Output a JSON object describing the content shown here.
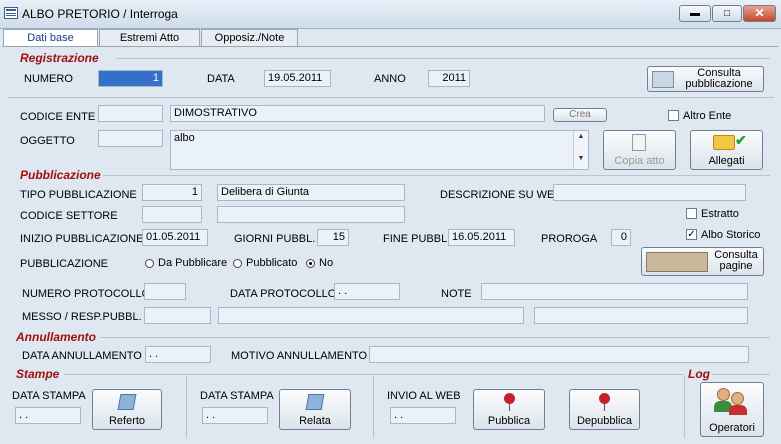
{
  "window": {
    "title": "ALBO PRETORIO / Interroga"
  },
  "tabs": [
    "Dati base",
    "Estremi Atto",
    "Opposiz./Note"
  ],
  "registrazione": {
    "heading": "Registrazione",
    "numero_label": "NUMERO",
    "numero": "1",
    "data_label": "DATA",
    "data": "19.05.2011",
    "anno_label": "ANNO",
    "anno": "2011",
    "consulta_pubb_btn": "Consulta pubblicazione"
  },
  "ente": {
    "codice_label": "CODICE ENTE",
    "codice": "",
    "descrizione": "DIMOSTRATIVO",
    "crea_btn": "Crea",
    "altro_ente_label": "Altro Ente",
    "oggetto_label": "OGGETTO",
    "oggetto_code": "",
    "oggetto": "albo",
    "copia_btn": "Copia atto",
    "allegati_btn": "Allegati"
  },
  "pubblicazione": {
    "heading": "Pubblicazione",
    "tipo_label": "TIPO PUBBLICAZIONE",
    "tipo_code": "1",
    "tipo": "Delibera di Giunta",
    "desc_web_label": "DESCRIZIONE SU WEB",
    "desc_web": "",
    "settore_label": "CODICE SETTORE",
    "settore_code": "",
    "settore": "",
    "estratto_label": "Estratto",
    "albo_storico_label": "Albo Storico",
    "inizio_label": "INIZIO PUBBLICAZIONE",
    "inizio": "01.05.2011",
    "giorni_label": "GIORNI PUBBL.",
    "giorni": "15",
    "fine_label": "FINE PUBBL.",
    "fine": "16.05.2011",
    "proroga_label": "PROROGA",
    "proroga": "0",
    "pubb_label": "PUBBLICAZIONE",
    "radio": [
      "Da Pubblicare",
      "Pubblicato",
      "No"
    ],
    "consulta_pagine_btn": "Consulta pagine",
    "protocollo_label": "NUMERO PROTOCOLLO",
    "protocollo": "",
    "data_prot_label": "DATA PROTOCOLLO",
    "data_prot": ". .",
    "note_label": "NOTE",
    "note": "",
    "messo_label": "MESSO / RESP.PUBBL."
  },
  "annullamento": {
    "heading": "Annullamento",
    "data_label": "DATA ANNULLAMENTO",
    "data": ". .",
    "motivo_label": "MOTIVO ANNULLAMENTO",
    "motivo": ""
  },
  "stampe": {
    "heading": "Stampe",
    "data_stampa1_label": "DATA STAMPA",
    "data_stampa1": ". .",
    "referto_btn": "Referto",
    "data_stampa2_label": "DATA STAMPA",
    "data_stampa2": ". .",
    "relata_btn": "Relata",
    "invio_label": "INVIO AL WEB",
    "invio": ". .",
    "pubblica_btn": "Pubblica",
    "depubblica_btn": "Depubblica"
  },
  "log": {
    "heading": "Log",
    "operatori_btn": "Operatori"
  },
  "colors": {
    "section": "#a01010",
    "field": "#eaf1f9",
    "selected": "#3470c9",
    "bg": "#dfe7f0"
  }
}
